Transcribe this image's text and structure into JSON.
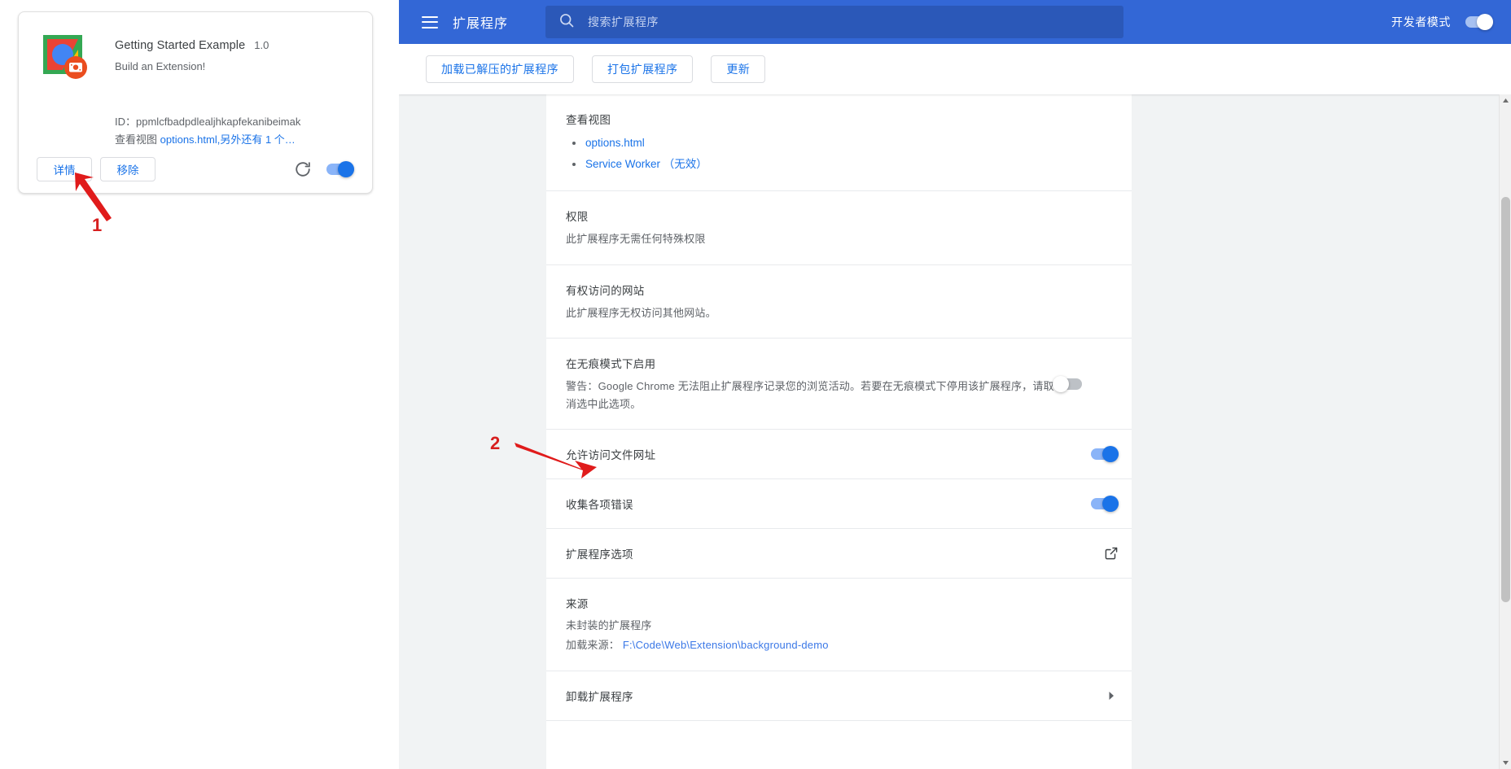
{
  "extension_card": {
    "name": "Getting Started Example",
    "version": "1.0",
    "description": "Build an Extension!",
    "id_label": "ID：",
    "id_value": "ppmlcfbadpdlealjhkapfekanibeimak",
    "views_label": "查看视图",
    "views_link": "options.html,另外还有 1 个…",
    "details_button": "详情",
    "remove_button": "移除",
    "reload_icon": "reload-icon",
    "enabled": true
  },
  "annotations": [
    {
      "number": "1"
    },
    {
      "number": "2"
    }
  ],
  "header": {
    "menu_icon": "hamburger-icon",
    "title": "扩展程序",
    "search_icon": "search-icon",
    "search_placeholder": "搜索扩展程序",
    "search_value": "",
    "devmode_label": "开发者模式",
    "devmode_on": true,
    "background_color": "#3367d6"
  },
  "toolbar": {
    "load_unpacked": "加载已解压的扩展程序",
    "pack_extension": "打包扩展程序",
    "update": "更新"
  },
  "detail": {
    "views": {
      "title": "查看视图",
      "items": [
        {
          "label": "options.html",
          "suffix": ""
        },
        {
          "label": "Service Worker",
          "suffix": "（无效）"
        }
      ]
    },
    "permissions": {
      "title": "权限",
      "text": "此扩展程序无需任何特殊权限"
    },
    "site_access": {
      "title": "有权访问的网站",
      "text": "此扩展程序无权访问其他网站。"
    },
    "incognito": {
      "title": "在无痕模式下启用",
      "text": "警告：Google Chrome 无法阻止扩展程序记录您的浏览活动。若要在无痕模式下停用该扩展程序，请取消选中此选项。",
      "enabled": false
    },
    "file_urls": {
      "title": "允许访问文件网址",
      "enabled": true
    },
    "collect_errors": {
      "title": "收集各项错误",
      "enabled": true
    },
    "options": {
      "title": "扩展程序选项",
      "icon": "external-link-icon"
    },
    "source": {
      "title": "来源",
      "type": "未封装的扩展程序",
      "load_label": "加载来源：",
      "path": "F:\\Code\\Web\\Extension\\background-demo"
    },
    "uninstall": {
      "title": "卸载扩展程序",
      "icon": "chevron-right-icon"
    }
  },
  "colors": {
    "accent_blue": "#1a73e8",
    "header_blue": "#3367d6",
    "annotation_red": "#d71f1f",
    "page_bg": "#f1f3f4"
  }
}
